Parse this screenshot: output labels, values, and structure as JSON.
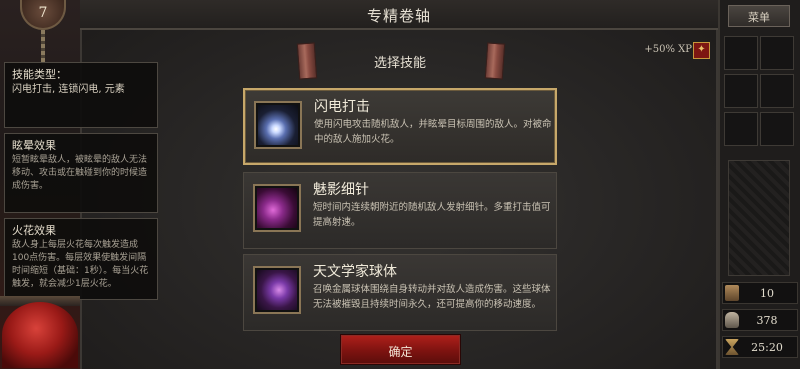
{
  "window": {
    "title": "专精卷轴"
  },
  "player": {
    "level": "7"
  },
  "header": {
    "subtitle": "选择技能",
    "xp_bonus": "+50% XP"
  },
  "icons": {
    "scroll_left": "scroll-icon",
    "scroll_right": "scroll-icon",
    "xp_badge": "xp-tome-icon",
    "xp_badge_glyph": "✦"
  },
  "left_panels": [
    {
      "title": "技能类型：",
      "body": "闪电打击, 连锁闪电, 元素"
    },
    {
      "title": "眩晕效果",
      "body": "短暂眩晕敌人，被眩晕的敌人无法移动、攻击或在触碰到你的时候造成伤害。"
    },
    {
      "title": "火花效果",
      "body": "敌人身上每层火花每次触发造成100点伤害。每层效果使触发间隔时间缩短（基础：1秒）。每当火花触发，就会减少1层火花。"
    }
  ],
  "skills": [
    {
      "name": "闪电打击",
      "description": "使用闪电攻击随机敌人，并眩晕目标周围的敌人。对被命中的敌人施加火花。",
      "icon": "lightning-strike-icon",
      "selected": true
    },
    {
      "name": "魅影细针",
      "description": "短时间内连续朝附近的随机敌人发射细针。多重打击值可提高射速。",
      "icon": "phantom-needles-icon",
      "selected": false
    },
    {
      "name": "天文学家球体",
      "description": "召唤金属球体围绕自身转动并对敌人造成伤害。这些球体无法被摧毁且持续时间永久，还可提高你的移动速度。",
      "icon": "astronomer-orb-icon",
      "selected": false
    }
  ],
  "confirm": {
    "label": "确定"
  },
  "menu": {
    "label": "菜单"
  },
  "stats": [
    {
      "icon": "gold-icon",
      "value": "10"
    },
    {
      "icon": "skull-icon",
      "value": "378"
    },
    {
      "icon": "hourglass-icon",
      "value": "25:20"
    }
  ],
  "colors": {
    "accent_gold": "#c7a86a",
    "confirm_red": "#b0201b",
    "health_orb": "#d8423a"
  }
}
